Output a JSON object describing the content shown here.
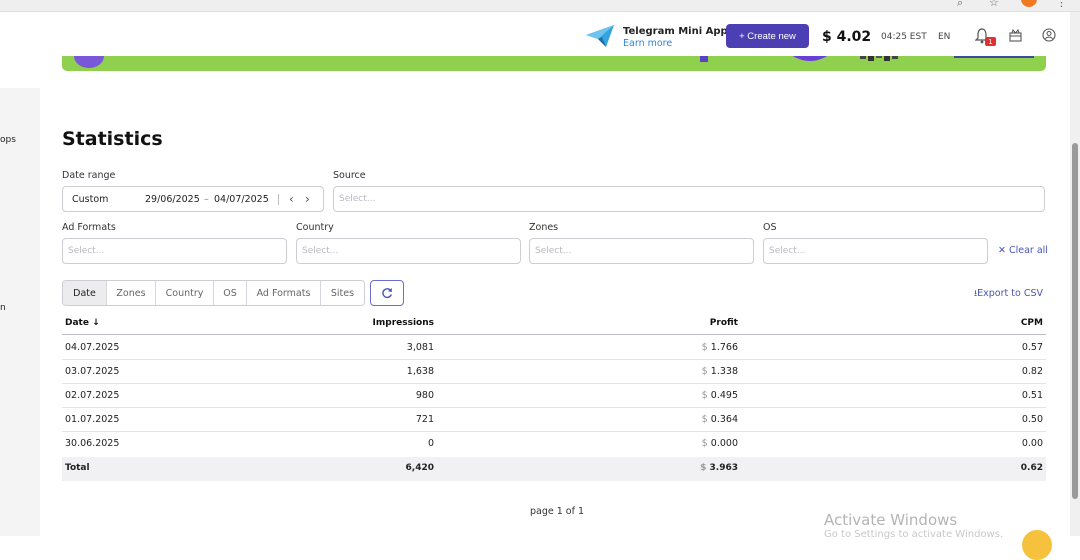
{
  "header": {
    "promo_title": "Telegram Mini Apps",
    "promo_sub": "Earn more",
    "create_label": "+ Create new",
    "balance": "$ 4.02",
    "time": "04:25 EST",
    "language": "EN",
    "notification_count": "1"
  },
  "sidebar": {
    "text1": "ops",
    "text2": "n"
  },
  "page": {
    "title": "Statistics"
  },
  "filters": {
    "date_range_label": "Date range",
    "date_mode": "Custom",
    "date_from": "29/06/2025",
    "date_sep": "–",
    "date_to": "04/07/2025",
    "source_label": "Source",
    "source_placeholder": "Select...",
    "ad_formats_label": "Ad Formats",
    "ad_formats_placeholder": "Select...",
    "country_label": "Country",
    "country_placeholder": "Select...",
    "zones_label": "Zones",
    "zones_placeholder": "Select...",
    "os_label": "OS",
    "os_placeholder": "Select...",
    "clear_all": "✕ Clear all"
  },
  "group_tabs": [
    {
      "label": "Date",
      "active": true
    },
    {
      "label": "Zones",
      "active": false
    },
    {
      "label": "Country",
      "active": false
    },
    {
      "label": "OS",
      "active": false
    },
    {
      "label": "Ad Formats",
      "active": false
    },
    {
      "label": "Sites",
      "active": false
    }
  ],
  "export_label": "Export to CSV",
  "table": {
    "headers": {
      "date": "Date ↓",
      "impressions": "Impressions",
      "profit": "Profit",
      "cpm": "CPM"
    },
    "currency": "$",
    "rows": [
      {
        "date": "04.07.2025",
        "impressions": "3,081",
        "profit": "1.766",
        "cpm": "0.57"
      },
      {
        "date": "03.07.2025",
        "impressions": "1,638",
        "profit": "1.338",
        "cpm": "0.82"
      },
      {
        "date": "02.07.2025",
        "impressions": "980",
        "profit": "0.495",
        "cpm": "0.51"
      },
      {
        "date": "01.07.2025",
        "impressions": "721",
        "profit": "0.364",
        "cpm": "0.50"
      },
      {
        "date": "30.06.2025",
        "impressions": "0",
        "profit": "0.000",
        "cpm": "0.00"
      }
    ],
    "total": {
      "label": "Total",
      "impressions": "6,420",
      "profit": "3.963",
      "cpm": "0.62"
    }
  },
  "pagination": "page 1 of 1",
  "watermark": {
    "title": "Activate Windows",
    "sub": "Go to Settings to activate Windows."
  },
  "colors": {
    "accent": "#4b3fb3",
    "banner": "#8fd14f",
    "link": "#4a55b5"
  },
  "icons": [
    "telegram-icon",
    "bell-icon",
    "gift-icon",
    "user-icon",
    "chevron-left-icon",
    "chevron-right-icon",
    "refresh-icon",
    "download-icon",
    "sort-down-icon"
  ]
}
